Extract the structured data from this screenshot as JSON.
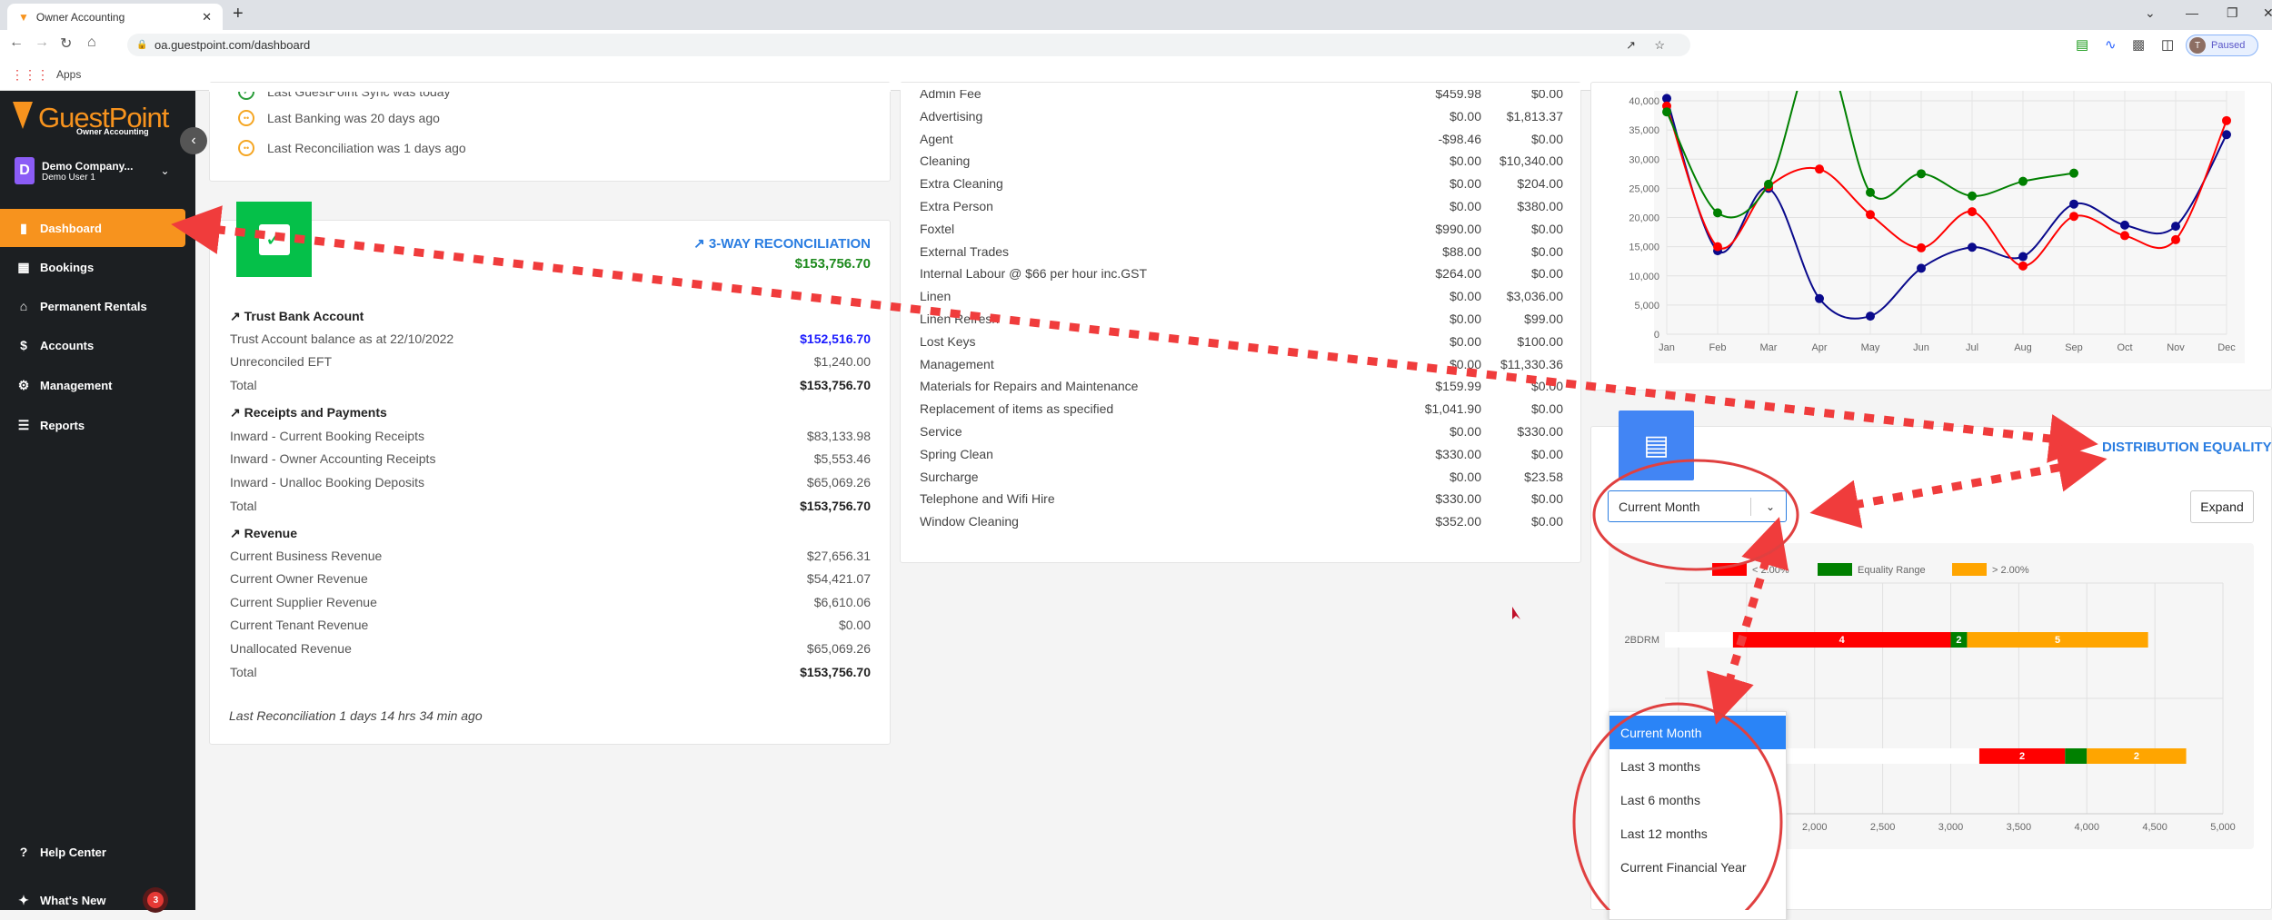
{
  "browser": {
    "tab_title": "Owner Accounting",
    "url": "oa.guestpoint.com/dashboard",
    "bookmarks_apps": "Apps",
    "profile_initial": "T",
    "profile_status": "Paused"
  },
  "sidebar": {
    "brand": "GuestPoint",
    "brand_sub": "Owner Accounting",
    "company": "Demo Company...",
    "user": "Demo User 1",
    "avatar_letter": "D",
    "items": [
      {
        "label": "Dashboard",
        "icon": "bar-chart-icon",
        "active": true
      },
      {
        "label": "Bookings",
        "icon": "calendar-icon"
      },
      {
        "label": "Permanent Rentals",
        "icon": "house-icon"
      },
      {
        "label": "Accounts",
        "icon": "dollar-icon"
      },
      {
        "label": "Management",
        "icon": "user-gear-icon"
      },
      {
        "label": "Reports",
        "icon": "report-icon"
      }
    ],
    "help": "Help Center",
    "whats_new": "What's New",
    "whats_new_count": "3",
    "accent": "#f7931e"
  },
  "status": {
    "items": [
      "Last GuestPoint Sync was today",
      "Last Banking was 20 days ago",
      "Last Reconciliation was 1 days ago"
    ]
  },
  "reconciliation": {
    "link": "3-WAY RECONCILIATION",
    "total": "$153,756.70",
    "trust": {
      "title": "Trust Bank Account",
      "rows": [
        {
          "label": "Trust Account balance as at 22/10/2022",
          "value": "$152,516.70"
        },
        {
          "label": "Unreconciled EFT",
          "value": "$1,240.00"
        },
        {
          "label": "Total",
          "value": "$153,756.70"
        }
      ]
    },
    "receipts": {
      "title": "Receipts and Payments",
      "rows": [
        {
          "label": "Inward - Current Booking Receipts",
          "value": "$83,133.98"
        },
        {
          "label": "Inward - Owner Accounting Receipts",
          "value": "$5,553.46"
        },
        {
          "label": "Inward - Unalloc Booking Deposits",
          "value": "$65,069.26"
        },
        {
          "label": "Total",
          "value": "$153,756.70"
        }
      ]
    },
    "revenue": {
      "title": "Revenue",
      "rows": [
        {
          "label": "Current Business Revenue",
          "value": "$27,656.31"
        },
        {
          "label": "Current Owner Revenue",
          "value": "$54,421.07"
        },
        {
          "label": "Current Supplier Revenue",
          "value": "$6,610.06"
        },
        {
          "label": "Current Tenant Revenue",
          "value": "$0.00"
        },
        {
          "label": "Unallocated Revenue",
          "value": "$65,069.26"
        },
        {
          "label": "Total",
          "value": "$153,756.70"
        }
      ]
    },
    "last": "Last Reconciliation 1 days 14 hrs 34 min ago"
  },
  "expenses": [
    [
      "Admin Fee",
      "$459.98",
      "$0.00"
    ],
    [
      "Advertising",
      "$0.00",
      "$1,813.37"
    ],
    [
      "Agent",
      "-$98.46",
      "$0.00"
    ],
    [
      "Cleaning",
      "$0.00",
      "$10,340.00"
    ],
    [
      "Extra Cleaning",
      "$0.00",
      "$204.00"
    ],
    [
      "Extra Person",
      "$0.00",
      "$380.00"
    ],
    [
      "Foxtel",
      "$990.00",
      "$0.00"
    ],
    [
      "External Trades",
      "$88.00",
      "$0.00"
    ],
    [
      "Internal Labour @ $66 per hour inc.GST",
      "$264.00",
      "$0.00"
    ],
    [
      "Linen",
      "$0.00",
      "$3,036.00"
    ],
    [
      "Linen Refresh",
      "$0.00",
      "$99.00"
    ],
    [
      "Lost Keys",
      "$0.00",
      "$100.00"
    ],
    [
      "Management",
      "$0.00",
      "$11,330.36"
    ],
    [
      "Materials for Repairs and Maintenance",
      "$159.99",
      "$0.00"
    ],
    [
      "Replacement of items as specified",
      "$1,041.90",
      "$0.00"
    ],
    [
      "Service",
      "$0.00",
      "$330.00"
    ],
    [
      "Spring Clean",
      "$330.00",
      "$0.00"
    ],
    [
      "Surcharge",
      "$0.00",
      "$23.58"
    ],
    [
      "Telephone and Wifi Hire",
      "$330.00",
      "$0.00"
    ],
    [
      "Window Cleaning",
      "$352.00",
      "$0.00"
    ]
  ],
  "distribution": {
    "title": "DISTRIBUTION EQUALITY",
    "select_value": "Current Month",
    "options": [
      "Current Month",
      "Last 3 months",
      "Last 6 months",
      "Last 12 months",
      "Current Financial Year"
    ],
    "expand": "Expand"
  },
  "chart_data": [
    {
      "type": "line",
      "categories": [
        "Jan",
        "Feb",
        "Mar",
        "Apr",
        "May",
        "Jun",
        "Jul",
        "Aug",
        "Sep",
        "Oct",
        "Nov",
        "Dec"
      ],
      "ylim": [
        0,
        40000
      ],
      "yticks": [
        "0",
        "5,000",
        "10,000",
        "15,000",
        "20,000",
        "25,000",
        "30,000",
        "35,000",
        "40,000"
      ],
      "grid": true,
      "series": [
        {
          "color": "#0a0a8c",
          "values": [
            40400,
            14300,
            25000,
            6100,
            3100,
            11300,
            14900,
            13300,
            22300,
            18700,
            18500,
            34200
          ]
        },
        {
          "color": "#ff0000",
          "values": [
            39100,
            15000,
            25300,
            28300,
            20500,
            14800,
            21000,
            11700,
            20200,
            16900,
            16200,
            36600
          ]
        },
        {
          "color": "#008000",
          "values": [
            38100,
            20800,
            25700,
            50000,
            24300,
            27500,
            23700,
            26200,
            27600,
            null,
            null,
            null
          ]
        }
      ]
    },
    {
      "type": "bar",
      "orientation": "horizontal-stacked",
      "categories": [
        "2BDRM",
        ""
      ],
      "xlim": [
        900,
        5000
      ],
      "xticks": [
        "2,000",
        "2,500",
        "3,000",
        "3,500",
        "4,000",
        "4,500",
        "5,000"
      ],
      "legend": [
        "< 2.00%",
        "Equality Range",
        "> 2.00%"
      ],
      "legend_position": "top",
      "colors": [
        "#ff0000",
        "#008000",
        "#ffa500"
      ],
      "rows": [
        {
          "start": 1400,
          "segments": [
            {
              "end": 3000,
              "label": "4"
            },
            {
              "end": 3120,
              "label": "2"
            },
            {
              "end": 4450,
              "label": "5"
            }
          ]
        },
        {
          "start": 3210,
          "segments": [
            {
              "end": 3840,
              "label": "2"
            },
            {
              "end": 4000,
              "label": ""
            },
            {
              "end": 4730,
              "label": "2"
            }
          ]
        }
      ]
    }
  ]
}
